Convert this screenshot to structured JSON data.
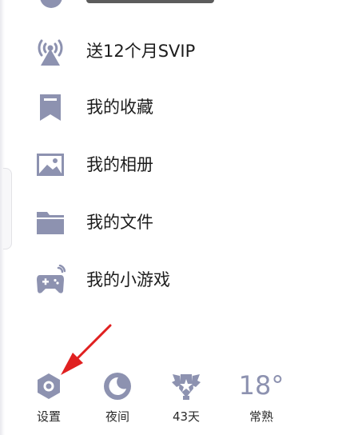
{
  "menu": {
    "items": [
      {
        "label": "送12个月SVIP",
        "icon": "antenna-icon"
      },
      {
        "label": "我的收藏",
        "icon": "bookmark-icon"
      },
      {
        "label": "我的相册",
        "icon": "picture-icon"
      },
      {
        "label": "我的文件",
        "icon": "folder-icon"
      },
      {
        "label": "我的小游戏",
        "icon": "gamepad-icon"
      }
    ]
  },
  "bottom_bar": {
    "settings_label": "设置",
    "night_label": "夜间",
    "days_label": "43天",
    "temperature": "18°",
    "weather_label": "常熟"
  },
  "colors": {
    "icon": "#8d92b0",
    "annotation_arrow": "#e02020"
  }
}
